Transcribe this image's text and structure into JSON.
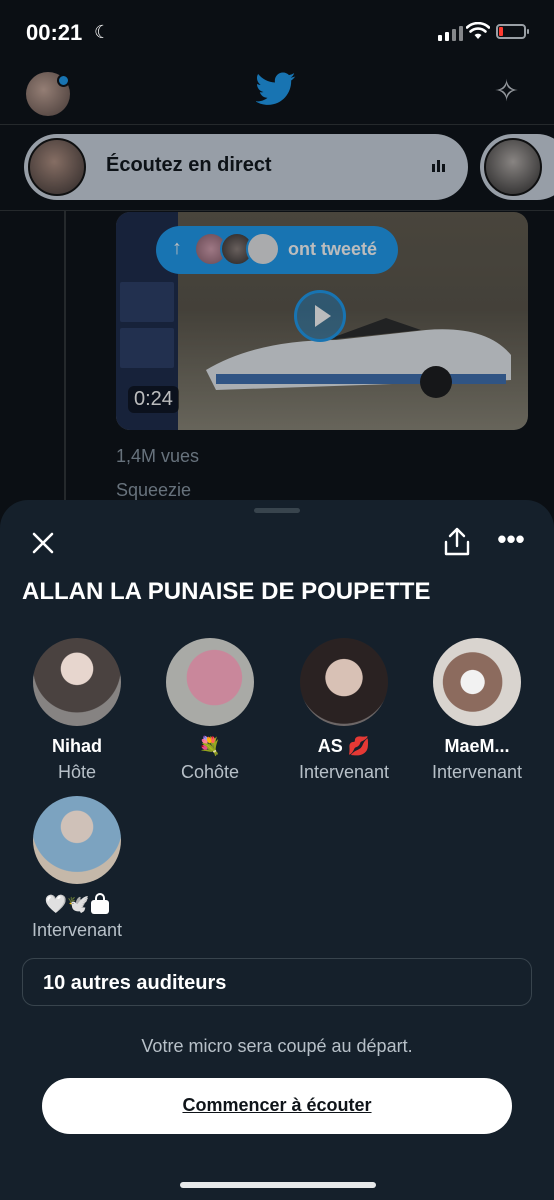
{
  "status_bar": {
    "time": "00:21",
    "moon_icon": "moon-icon",
    "battery_color": "#ff3b30"
  },
  "header": {
    "bird_icon": "twitter-bird-icon",
    "sparkle_icon": "sparkle-icon"
  },
  "spaces_bar": {
    "live_label": "Écoutez en direct"
  },
  "tweet": {
    "video_duration": "0:24",
    "tweeted_label": "ont tweeté",
    "views": "1,4M vues",
    "author": "Squeezie"
  },
  "sheet": {
    "title": "ALLAN LA PUNAISE DE POUPETTE",
    "people": [
      {
        "name": "Nihad",
        "role": "Hôte"
      },
      {
        "name": "💐",
        "role": "Cohôte"
      },
      {
        "name": "AS 💋",
        "role": "Intervenant"
      },
      {
        "name": "MaeM...",
        "role": "Intervenant"
      },
      {
        "name": "🤍🕊️",
        "role": "Intervenant"
      }
    ],
    "listeners": "10 autres auditeurs",
    "mic_note": "Votre micro sera coupé au départ.",
    "start_button": "Commencer à écouter"
  },
  "colors": {
    "accent": "#1d9bf0",
    "sheet_bg": "#15202b"
  }
}
